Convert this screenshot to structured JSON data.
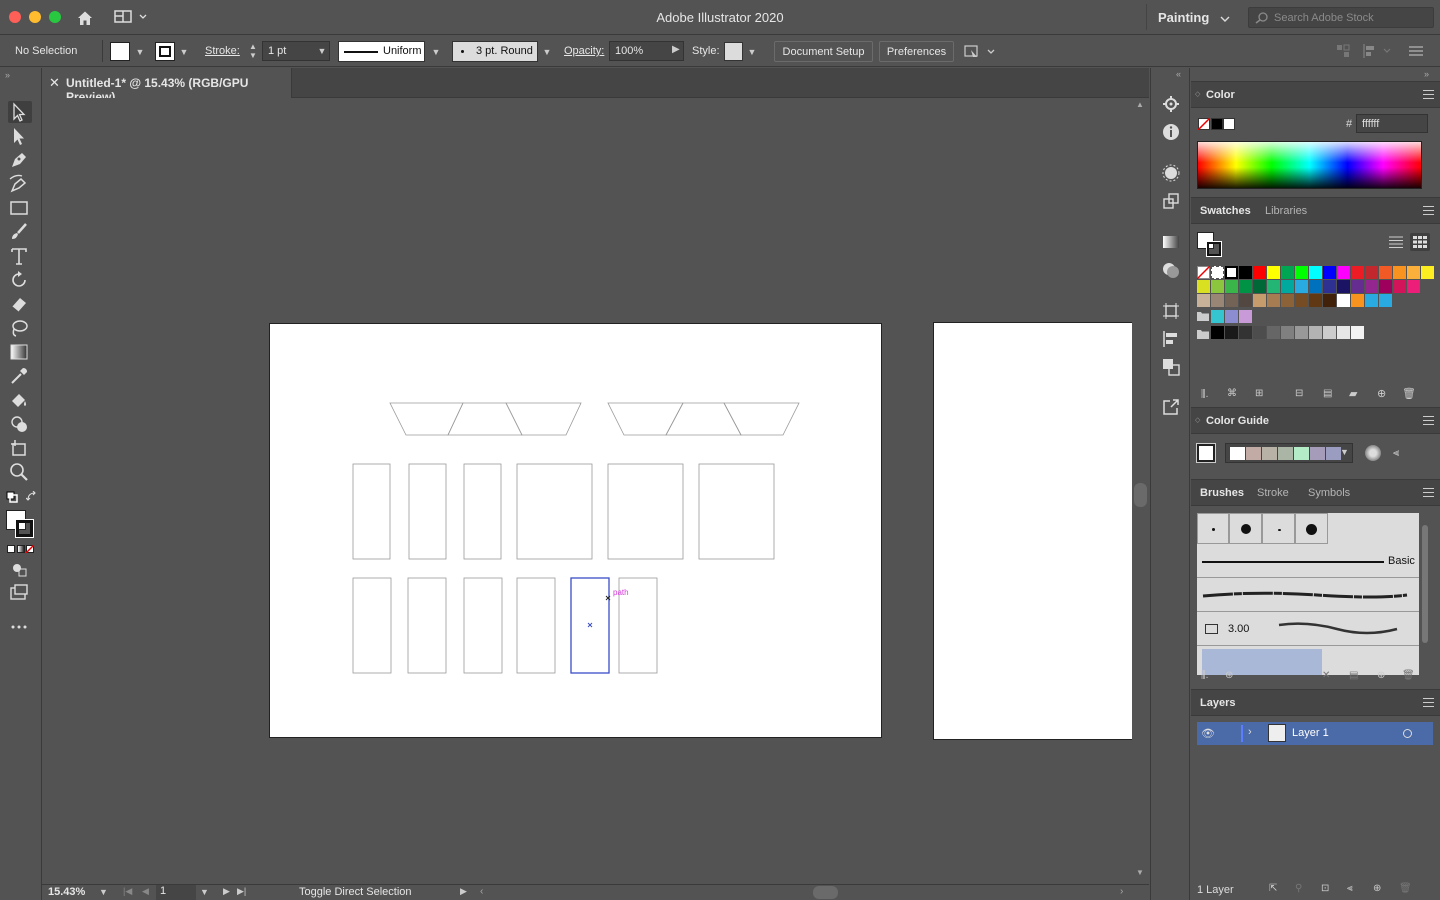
{
  "titlebar": {
    "app_title": "Adobe Illustrator 2020",
    "workspace": "Painting",
    "stock_search_placeholder": "Search Adobe Stock"
  },
  "controlbar": {
    "selection_status": "No Selection",
    "stroke_label": "Stroke:",
    "stroke_weight": "1 pt",
    "stroke_profile": "Uniform",
    "brush_def": "3 pt. Round",
    "opacity_label": "Opacity:",
    "opacity_value": "100%",
    "style_label": "Style:",
    "document_setup": "Document Setup",
    "preferences": "Preferences"
  },
  "document": {
    "tab_title": "Untitled-1* @ 15.43% (RGB/GPU Preview)",
    "smart_guide_label": "path"
  },
  "statusbar": {
    "zoom": "15.43%",
    "artboard_number": "1",
    "status_text": "Toggle Direct Selection"
  },
  "panels": {
    "color": {
      "title": "Color",
      "hex_label": "#",
      "hex_value": "ffffff"
    },
    "swatches": {
      "tab_swatches": "Swatches",
      "tab_libraries": "Libraries",
      "row1": [
        "#ff0000",
        "#ffff00",
        "#00a651",
        "#00ff00",
        "#00ffff",
        "#0000ff",
        "#ff00ff",
        "#ed1c24",
        "#c1272d",
        "#f15a24",
        "#f7931e",
        "#fbb03b",
        "#fcee21"
      ],
      "row2": [
        "#d9e021",
        "#8cc63f",
        "#39b54a",
        "#009245",
        "#006837",
        "#22b573",
        "#00a99d",
        "#29abe2",
        "#0071bc",
        "#2e3192",
        "#1b1464",
        "#662d91",
        "#93278f",
        "#9e005d",
        "#d4145a",
        "#ed1e79"
      ],
      "row3": [
        "#c7b299",
        "#998675",
        "#736357",
        "#534741",
        "#c69c6d",
        "#a67c52",
        "#8c6239",
        "#754c24",
        "#603813",
        "#42210b",
        "#ffffff",
        "#f7931e",
        "#29abe2",
        "#29abe2"
      ],
      "row4": [
        "#34c5d0",
        "#8c8cd0",
        "#c89ad8"
      ],
      "row5": [
        "#000000",
        "#1a1a1a",
        "#333333",
        "#4d4d4d",
        "#666666",
        "#808080",
        "#999999",
        "#b3b3b3",
        "#cccccc",
        "#e6e6e6",
        "#f2f2f2"
      ]
    },
    "color_guide": {
      "title": "Color Guide",
      "harmony": [
        "#ffffff",
        "#c3aba5",
        "#b7b1a6",
        "#aab5a6",
        "#b4ecc8",
        "#a49cb8",
        "#9a9cc0"
      ]
    },
    "brushes": {
      "tab_brushes": "Brushes",
      "tab_stroke": "Stroke",
      "tab_symbols": "Symbols",
      "basic_label": "Basic",
      "size_value": "3.00"
    },
    "layers": {
      "title": "Layers",
      "layer_name": "Layer 1",
      "layer_count": "1 Layer"
    }
  },
  "colors": {
    "ui_bg": "#535353",
    "selection_blue": "#3a4dc8",
    "smart_guide_magenta": "#d63adb",
    "layer_highlight": "#4a6aa8"
  }
}
